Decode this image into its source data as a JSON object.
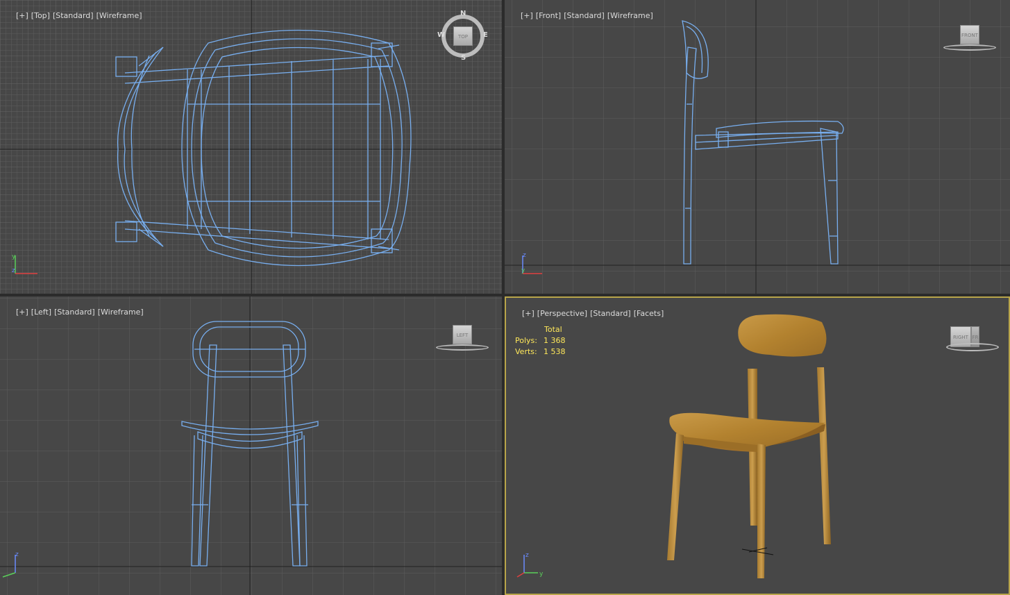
{
  "viewports": {
    "top": {
      "tags": [
        "[+]",
        "[Top]",
        "[Standard]",
        "[Wireframe]"
      ],
      "cube_label": "TOP",
      "compass": {
        "n": "N",
        "s": "S",
        "e": "E",
        "w": "W"
      }
    },
    "front": {
      "tags": [
        "[+]",
        "[Front]",
        "[Standard]",
        "[Wireframe]"
      ],
      "cube_label": "FRONT"
    },
    "left": {
      "tags": [
        "[+]",
        "[Left]",
        "[Standard]",
        "[Wireframe]"
      ],
      "cube_label": "LEFT"
    },
    "perspective": {
      "tags": [
        "[+]",
        "[Perspective]",
        "[Standard]",
        "[Facets]"
      ],
      "cube_label_right": "RIGHT",
      "cube_label_front": "FR",
      "stats": {
        "header": "Total",
        "polys_label": "Polys:",
        "polys_value": "1 368",
        "verts_label": "Verts:",
        "verts_value": "1 538"
      }
    }
  },
  "axes": {
    "x": "x",
    "y": "y",
    "z": "z"
  },
  "colors": {
    "wireframe": "#78aff0",
    "grid": "#595959",
    "grid_dense": "#5e5e5e",
    "axis_line": "#222222",
    "active_border": "#b8a54a",
    "wood": "#b98a3a",
    "stats_text": "#ffe85a"
  }
}
